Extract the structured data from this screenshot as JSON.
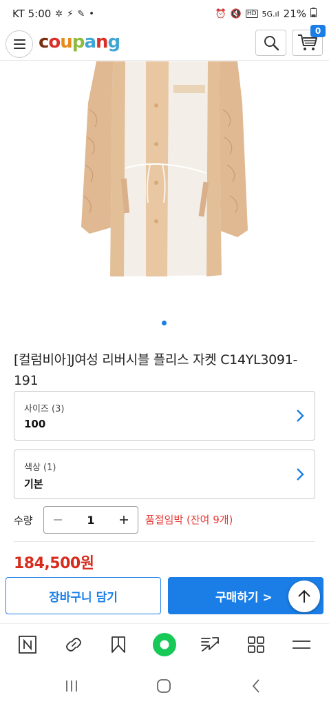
{
  "status_bar": {
    "carrier_time": "KT 5:00",
    "battery": "21%"
  },
  "header": {
    "logo_parts": [
      {
        "text": "c",
        "color": "#7a2e0e"
      },
      {
        "text": "o",
        "color": "#d8312a"
      },
      {
        "text": "u",
        "color": "#e58b1c"
      },
      {
        "text": "p",
        "color": "#8dbb3c"
      },
      {
        "text": "a",
        "color": "#3fa6d4"
      },
      {
        "text": "n",
        "color": "#d8312a"
      },
      {
        "text": "g",
        "color": "#3fa6d4"
      }
    ],
    "cart_count": "0"
  },
  "product": {
    "title": "[컬럼비아]J여성 리버시블 플리스 자켓 C14YL3091-191",
    "options": [
      {
        "label": "사이즈 (3)",
        "value": "100"
      },
      {
        "label": "색상 (1)",
        "value": "기본"
      }
    ],
    "quantity_label": "수량",
    "quantity": "1",
    "stock_note": "품절임박 (잔여 9개)",
    "price": "184,500원"
  },
  "actions": {
    "add_to_cart": "장바구니 담기",
    "buy_now": "구매하기 >"
  },
  "colors": {
    "accent": "#1a7ee6",
    "price": "#d72c1d",
    "stock_warning": "#e53935",
    "browser_home": "#19c957"
  },
  "browser_toolbar": {
    "icons": [
      "naver-n-icon",
      "link-icon",
      "bookmark-icon",
      "home-green-icon",
      "share-icon",
      "apps-grid-icon",
      "menu-lines-icon"
    ]
  },
  "nav_bar": {
    "icons": [
      "recent-apps-icon",
      "home-icon",
      "back-icon"
    ]
  }
}
